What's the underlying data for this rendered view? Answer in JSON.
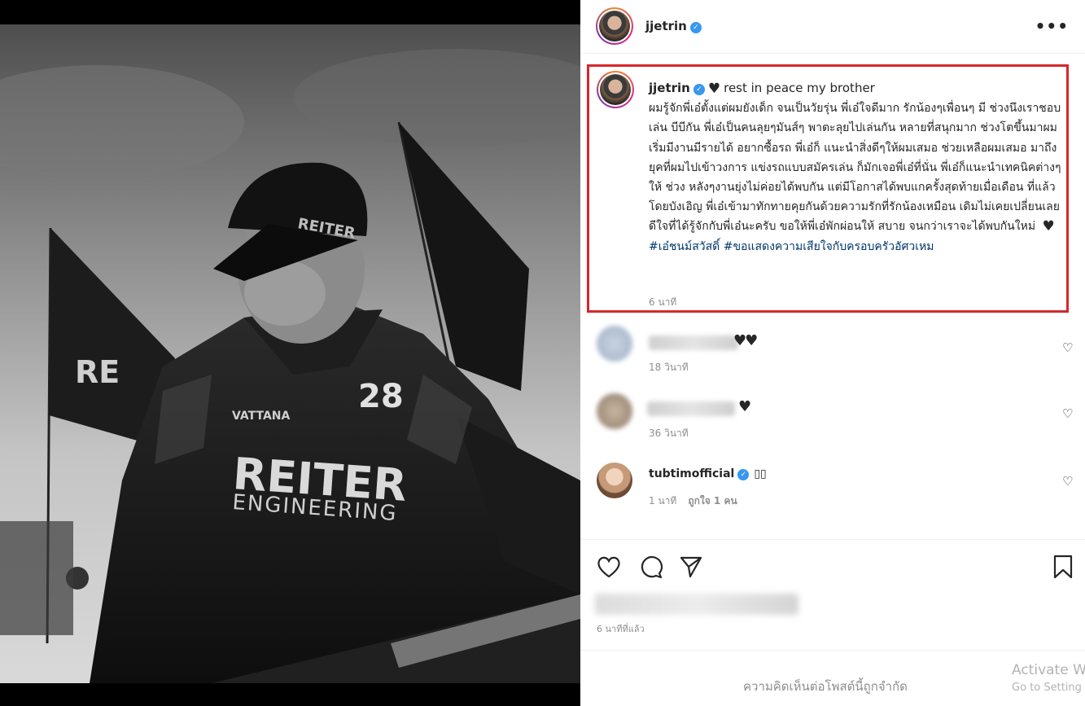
{
  "post": {
    "author": "jjetrin",
    "more_label": "•••",
    "caption": {
      "author": "jjetrin",
      "heading_text": "rest in peace my brother",
      "body": "ผมรู้จักพี่เอ๋ตั้งแต่ผมยังเด็ก จนเป็นวัยรุ่น พี่เอ๋ใจดีมาก รักน้องๆเพื่อนๆ มี ช่วงนึงเราชอบเล่น บีบีกัน พี่เอ๋เป็นคนลุยๆมันส์ๆ พาตะลุยไปเล่นกัน หลายที่สนุกมาก ช่วงโตขึ้นมาผมเริ่มมีงานมีรายได้ อยากซื้อรถ พี่เอ๋ก็ แนะนำสิ่งดีๆให้ผมเสมอ ช่วยเหลือผมเสมอ มาถึงยุคที่ผมไปเข้าวงการ แข่งรถแบบสมัครเล่น ก็มักเจอพี่เอ๋ที่นั่น พี่เอ๋ก็แนะนำเทคนิคต่างๆให้ ช่วง หลังๆงานยุ่งไม่ค่อยได้พบกัน แต่มีโอกาสได้พบแกครั้งสุดท้ายเมื่อเดือน ที่แล้วโดยบังเอิญ พี่เอ๋เข้ามาทักทายคุยกันด้วยความรักที่รักน้องเหมือน เดิมไม่เคยเปลี่ยนเลย ดีใจที่ได้รู้จักกับพี่เอ๋นะครับ ขอให้พี่เอ๋พักผ่อนให้ สบาย จนกว่าเราจะได้พบกันใหม่",
      "hashtags": "#เอ๋ชนม์สวัสดิ์ #ขอแสดงความเสียใจกับครอบครัวอัศวเหม",
      "time": "6 นาที"
    },
    "comments": [
      {
        "user": "",
        "text": "",
        "time": "18 วินาที",
        "likes": ""
      },
      {
        "user": "",
        "text": "",
        "time": "36 วินาที",
        "likes": ""
      },
      {
        "user": "tubtimofficial",
        "text": "",
        "time": "1 นาที",
        "likes": "ถูกใจ 1 คน"
      }
    ],
    "icons": {
      "like": "heart-icon",
      "comment": "comment-icon",
      "share": "share-icon",
      "save": "bookmark-icon"
    },
    "posted_time": "6 นาทีที่แล้ว",
    "comments_limited": "ความคิดเห็นต่อโพสต์นี้ถูกจำกัด"
  },
  "photo": {
    "suit_brand": "REITER",
    "suit_sub": "ENGINEERING",
    "car_number": "28",
    "sponsor": "VATTANA"
  },
  "watermark": {
    "title": "Activate W",
    "subtitle": "Go to Setting"
  },
  "colors": {
    "highlight_border": "#d6262a",
    "verified": "#3897f0",
    "hashtag": "#00376b",
    "muted": "#8e8e8e"
  }
}
